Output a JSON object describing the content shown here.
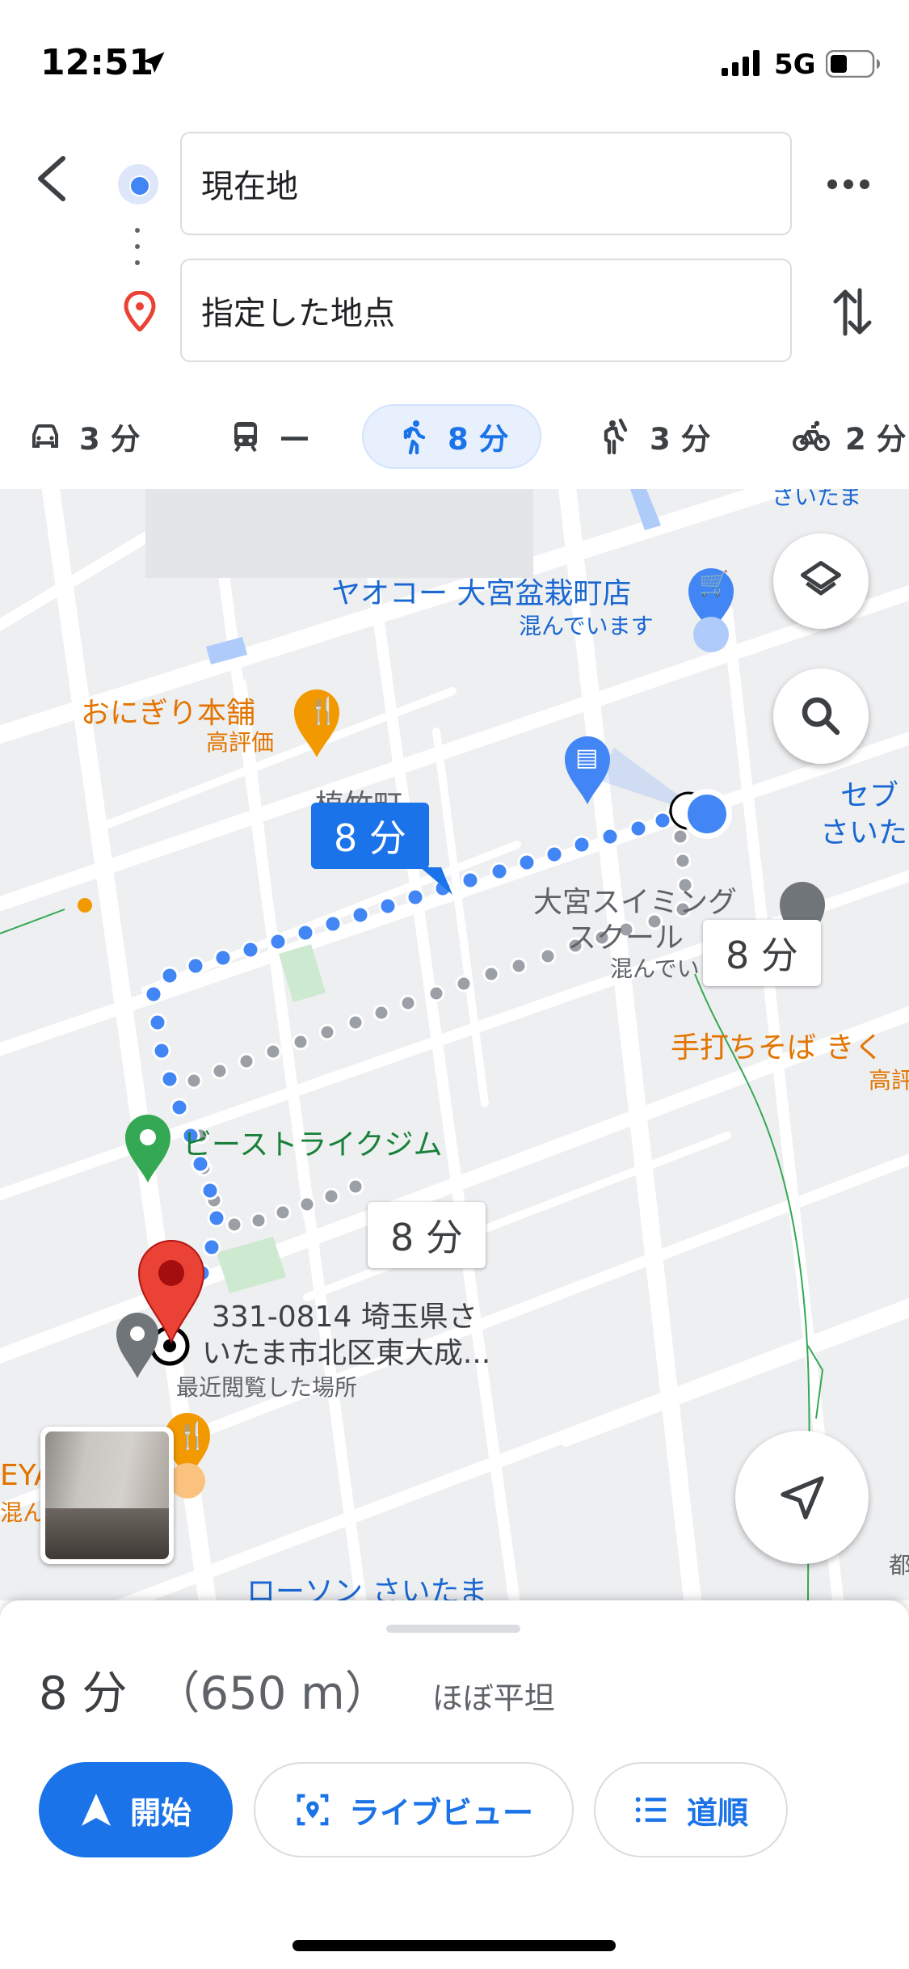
{
  "status_bar": {
    "time": "12:51",
    "network": "5G"
  },
  "directions": {
    "origin": "現在地",
    "destination": "指定した地点"
  },
  "modes": [
    {
      "icon": "car-icon",
      "label": "3 分"
    },
    {
      "icon": "transit-icon",
      "label": "—"
    },
    {
      "icon": "walk-icon",
      "label": "8 分",
      "active": true
    },
    {
      "icon": "ride-hail-icon",
      "label": "3 分"
    },
    {
      "icon": "bike-icon",
      "label": "2 分"
    }
  ],
  "map": {
    "labels": {
      "yaoko": "ヤオコー 大宮盆栽町店",
      "yaoko_sub": "混んでいます",
      "onigiri": "おにぎり本舗",
      "onigiri_sub": "高評価",
      "uetake": "植竹町",
      "swim1": "大宮スイミング",
      "swim2": "スクール",
      "swim_sub": "混んでいます",
      "seven1": "セブ",
      "seven2": "さいた",
      "soba": "手打ちそば きく",
      "soba_sub": "高評",
      "beast": "ビーストライクジム",
      "address1": "331-0814 埼玉県さ",
      "address2": "いたま市北区東大成...",
      "address_sub": "最近閲覧した場所",
      "lawson": "ローソン さいたま",
      "left_cut1": "EYA",
      "left_cut2": "混ん",
      "top_cut": "さいたま",
      "right_cut": "都"
    },
    "route_time_main": "8 分",
    "route_time_alt1": "8 分",
    "route_time_alt2": "8 分"
  },
  "sheet": {
    "duration": "8 分",
    "distance": "（650 m）",
    "terrain": "ほぼ平坦",
    "start_label": "開始",
    "live_view_label": "ライブビュー",
    "steps_label": "道順"
  },
  "colors": {
    "accent": "#1a73e8",
    "route": "#4285f4",
    "pin": "#ea4335"
  }
}
